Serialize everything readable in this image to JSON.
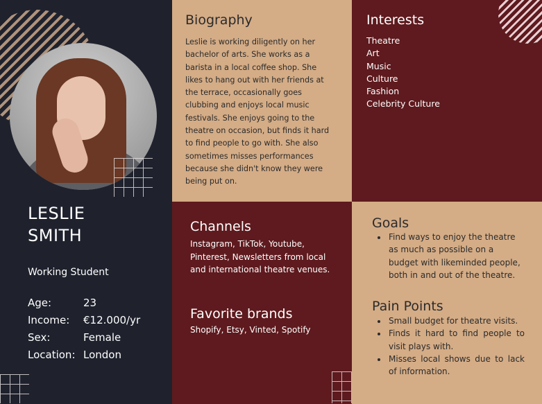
{
  "profile": {
    "name_first": "LESLIE",
    "name_last": "SMITH",
    "role": "Working Student",
    "facts": [
      {
        "label": "Age:",
        "value": "23"
      },
      {
        "label": "Income:",
        "value": "€12.000/yr"
      },
      {
        "label": "Sex:",
        "value": "Female"
      },
      {
        "label": "Location:",
        "value": "London"
      }
    ]
  },
  "biography": {
    "title": "Biography",
    "text": "Leslie is working diligently on her bachelor of arts. She works as a barista in a local coffee shop. She likes to hang out with her friends at the terrace, occasionally goes clubbing and enjoys local music festivals. She enjoys going to the theatre on occasion, but finds it hard to find people to go with. She also sometimes misses performances because she didn't know they were being put on."
  },
  "interests": {
    "title": "Interests",
    "items": [
      "Theatre",
      "Art",
      "Music",
      "Culture",
      "Fashion",
      "Celebrity Culture"
    ]
  },
  "channels": {
    "title": "Channels",
    "text": "Instagram, TikTok, Youtube, Pinterest, Newsletters from local and international theatre venues."
  },
  "brands": {
    "title": "Favorite brands",
    "text": "Shopify, Etsy, Vinted, Spotify"
  },
  "goals": {
    "title": "Goals",
    "items": [
      "Find ways to enjoy the theatre as much as possible on a budget with likeminded people, both in and out of the theatre."
    ]
  },
  "pain_points": {
    "title": "Pain Points",
    "items": [
      "Small budget for theatre visits.",
      "Finds it hard to find people to visit plays with.",
      "Misses local shows due to lack of information."
    ]
  },
  "colors": {
    "navy": "#1f222d",
    "tan": "#d4ac86",
    "maroon": "#5e1a1e"
  }
}
